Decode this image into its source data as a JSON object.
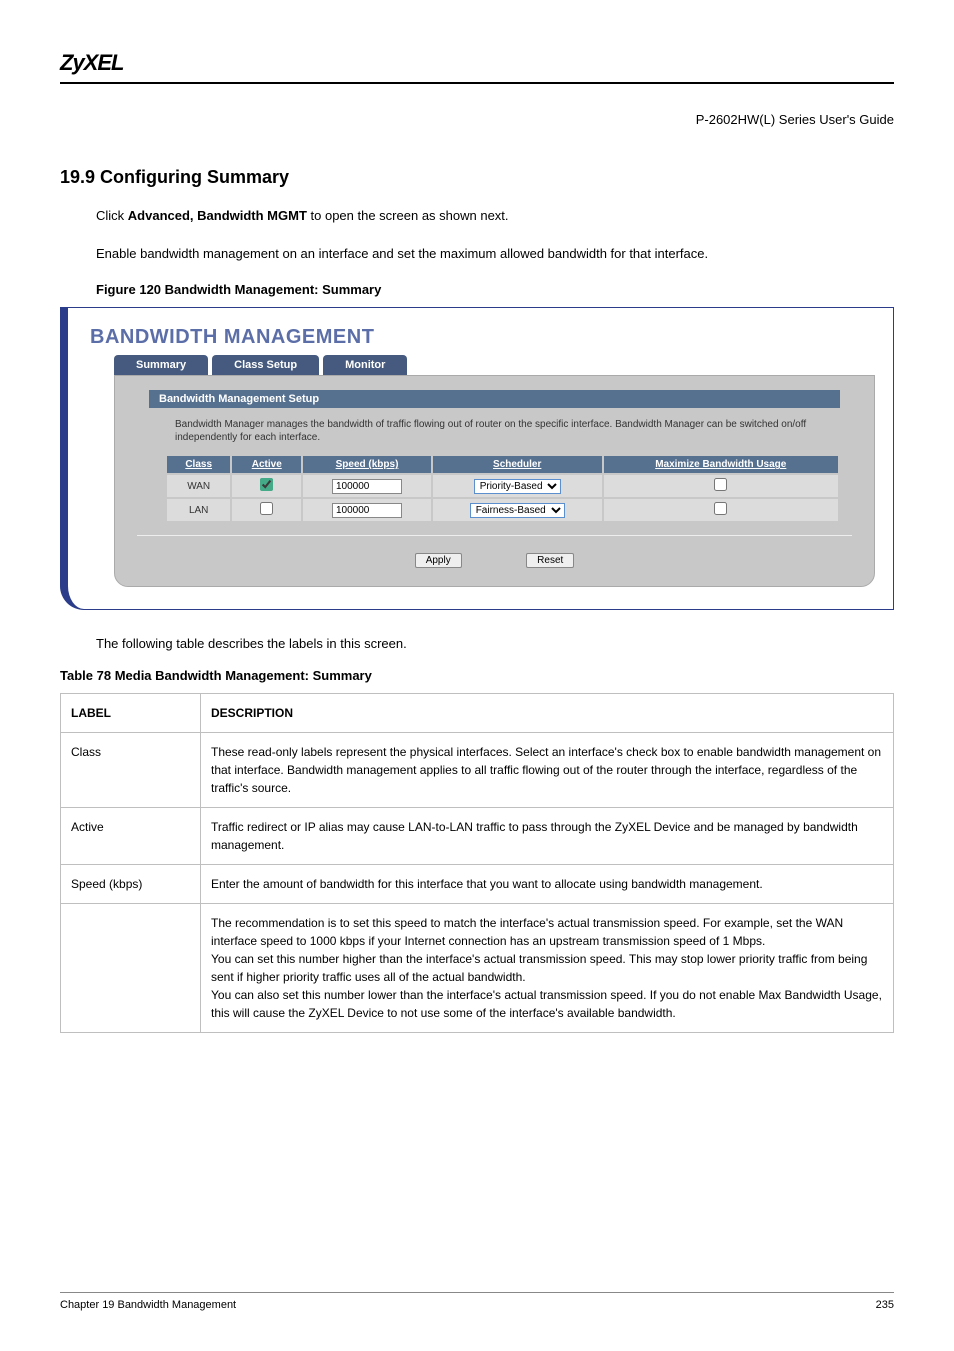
{
  "brand": "ZyXEL",
  "doc_title": "P-2602HW(L) Series User's Guide",
  "section_heading": "19.9  Configuring Summary",
  "para1_pre": "Click ",
  "para1_b1": "Advanced, Bandwidth MGMT",
  "para1_mid": " to open the screen as shown next.",
  "para2": "Enable bandwidth management on an interface and set the maximum allowed bandwidth for that interface.",
  "fig_caption_num": "Figure 120   ",
  "fig_caption_txt": "Bandwidth Management: Summary",
  "shot": {
    "title": "BANDWIDTH MANAGEMENT",
    "tabs": [
      "Summary",
      "Class Setup",
      "Monitor"
    ],
    "panel_header": "Bandwidth Management Setup",
    "panel_desc": "Bandwidth Manager manages the bandwidth of traffic flowing out of router on the specific interface. Bandwidth Manager can be switched on/off independently for each interface.",
    "cols": [
      "Class",
      "Active",
      "Speed (kbps)",
      "Scheduler",
      "Maximize Bandwidth Usage"
    ],
    "rows": [
      {
        "class": "WAN",
        "active": true,
        "speed": "100000",
        "scheduler": "Priority-Based",
        "max": false
      },
      {
        "class": "LAN",
        "active": false,
        "speed": "100000",
        "scheduler": "Fairness-Based",
        "max": false
      }
    ],
    "apply": "Apply",
    "reset": "Reset"
  },
  "tbl_intro": "The following table describes the labels in this screen.",
  "tbl_caption_num": "Table 78   ",
  "tbl_caption_txt": "Media Bandwidth Management: Summary",
  "tbl_head": [
    "LABEL",
    "DESCRIPTION"
  ],
  "tbl_rows": [
    {
      "label": "Class",
      "desc": "These read-only labels represent the physical interfaces. Select an interface's check box to enable bandwidth management on that interface. Bandwidth management applies to all traffic flowing out of the router through the interface, regardless of the traffic's source."
    },
    {
      "label": "Active",
      "desc": "Traffic redirect or IP alias may cause LAN-to-LAN traffic to pass through the ZyXEL Device and be managed by bandwidth management."
    },
    {
      "label": "Speed (kbps)",
      "desc": "Enter the amount of bandwidth for this interface that you want to allocate using bandwidth management."
    },
    {
      "label": "",
      "desc": "The recommendation is to set this speed to match the interface's actual transmission speed. For example, set the WAN interface speed to 1000 kbps if your Internet connection has an upstream transmission speed of 1 Mbps.\nYou can set this number higher than the interface's actual transmission speed. This may stop lower priority traffic from being sent if higher priority traffic uses all of the actual bandwidth.\nYou can also set this number lower than the interface's actual transmission speed. If you do not enable Max Bandwidth Usage, this will cause the ZyXEL Device to not use some of the interface's available bandwidth."
    }
  ],
  "footer_left": "Chapter 19 Bandwidth Management",
  "footer_right": "235"
}
